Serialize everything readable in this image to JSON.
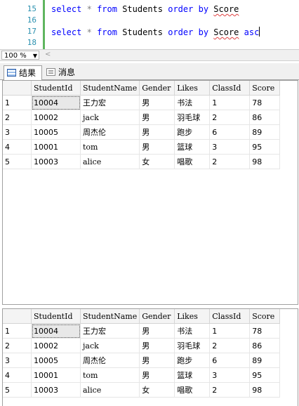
{
  "editor": {
    "line_numbers": [
      "15",
      "16",
      "17",
      "18"
    ],
    "query1": {
      "select": "select",
      "star": "*",
      "from": "from",
      "table": "Students",
      "order": "order",
      "by": "by",
      "col": "Score"
    },
    "query2": {
      "select": "select",
      "star": "*",
      "from": "from",
      "table": "Students",
      "order": "order",
      "by": "by",
      "col": "Score",
      "dir": "asc"
    }
  },
  "zoom": {
    "value": "100 %"
  },
  "tabs": {
    "results": "结果",
    "messages": "消息"
  },
  "results": {
    "columns": [
      "StudentId",
      "StudentName",
      "Gender",
      "Likes",
      "ClassId",
      "Score"
    ],
    "grid1": [
      {
        "n": "1",
        "id": "10004",
        "name": "王力宏",
        "gender": "男",
        "likes": "书法",
        "class": "1",
        "score": "78"
      },
      {
        "n": "2",
        "id": "10002",
        "name": "jack",
        "gender": "男",
        "likes": "羽毛球",
        "class": "2",
        "score": "86"
      },
      {
        "n": "3",
        "id": "10005",
        "name": "周杰伦",
        "gender": "男",
        "likes": "跑步",
        "class": "6",
        "score": "89"
      },
      {
        "n": "4",
        "id": "10001",
        "name": "tom",
        "gender": "男",
        "likes": "篮球",
        "class": "3",
        "score": "95"
      },
      {
        "n": "5",
        "id": "10003",
        "name": "alice",
        "gender": "女",
        "likes": "唱歌",
        "class": "2",
        "score": "98"
      }
    ],
    "grid2": [
      {
        "n": "1",
        "id": "10004",
        "name": "王力宏",
        "gender": "男",
        "likes": "书法",
        "class": "1",
        "score": "78"
      },
      {
        "n": "2",
        "id": "10002",
        "name": "jack",
        "gender": "男",
        "likes": "羽毛球",
        "class": "2",
        "score": "86"
      },
      {
        "n": "3",
        "id": "10005",
        "name": "周杰伦",
        "gender": "男",
        "likes": "跑步",
        "class": "6",
        "score": "89"
      },
      {
        "n": "4",
        "id": "10001",
        "name": "tom",
        "gender": "男",
        "likes": "篮球",
        "class": "3",
        "score": "95"
      },
      {
        "n": "5",
        "id": "10003",
        "name": "alice",
        "gender": "女",
        "likes": "唱歌",
        "class": "2",
        "score": "98"
      }
    ]
  }
}
